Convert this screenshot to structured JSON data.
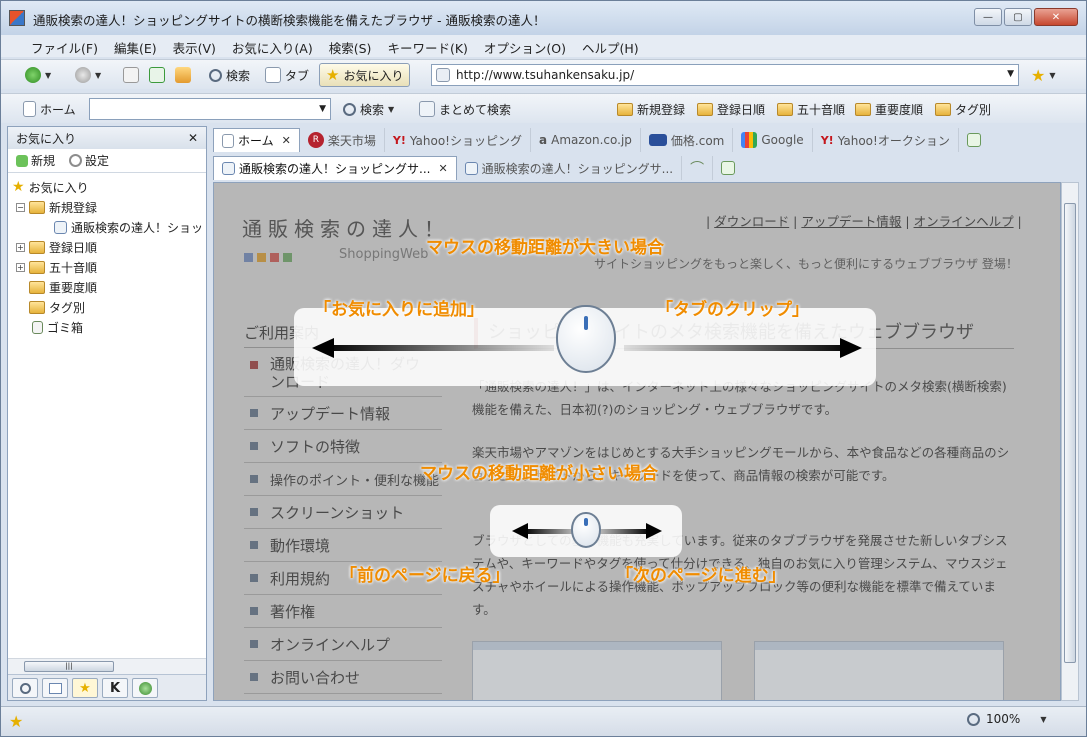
{
  "window": {
    "title": "通販検索の達人！ショッピングサイトの横断検索機能を備えたブラウザ - 通販検索の達人！",
    "controls": [
      "—",
      "▢",
      "✕"
    ]
  },
  "menu": [
    "ファイル(F)",
    "編集(E)",
    "表示(V)",
    "お気に入り(A)",
    "検索(S)",
    "キーワード(K)",
    "オプション(O)",
    "ヘルプ(H)"
  ],
  "toolbar": {
    "search_label": "検索",
    "tab_label": "タブ",
    "favorites_label": "お気に入り",
    "address": "http://www.tsuhankensaku.jp/"
  },
  "toolbar2": {
    "home_label": "ホーム",
    "search_label": "検索",
    "batch_search_label": "まとめて検索",
    "keywords": [
      "新規登録",
      "登録日順",
      "五十音順",
      "重要度順",
      "タグ別"
    ]
  },
  "sidebar": {
    "title": "お気に入り",
    "close": "✕",
    "new_label": "新規",
    "settings_label": "設定",
    "tree": [
      {
        "label": "お気に入り",
        "level": 0
      },
      {
        "label": "新規登録",
        "level": 1,
        "expander": "−"
      },
      {
        "label": "通販検索の達人！ショッ",
        "level": 2
      },
      {
        "label": "登録日順",
        "level": 1,
        "expander": "+"
      },
      {
        "label": "五十音順",
        "level": 1,
        "expander": "+"
      },
      {
        "label": "重要度順",
        "level": 1
      },
      {
        "label": "タグ別",
        "level": 1
      },
      {
        "label": "ゴミ箱",
        "level": 1
      }
    ],
    "bottom_k": "K"
  },
  "tabs_row1": [
    "ホーム",
    "楽天市場",
    "Yahoo!ショッピング",
    "Amazon.co.jp",
    "価格.com",
    "Google",
    "Yahoo!オークション"
  ],
  "tabs_row2": [
    "通販検索の達人！ショッピングサ...",
    "通販検索の達人！ショッピングサ..."
  ],
  "tab_close": "✕",
  "page": {
    "title": "通販検索の達人！",
    "subtitle": "ShoppingWeb",
    "links": [
      "ダウンロード",
      "アップデート情報",
      "オンラインヘルプ"
    ],
    "tagline": "サイトショッピングをもっと楽しく、もっと便利にするウェブブラウザ 登場！",
    "guide_title": "ご利用案内",
    "nav": [
      "通販検索の達人！ダウンロード",
      "アップデート情報",
      "ソフトの特徴",
      "操作のポイント・便利な機能",
      "スクリーンショット",
      "動作環境",
      "利用規約",
      "著作権",
      "オンラインヘルプ",
      "お問い合わせ"
    ],
    "section_head": "ショッピングサイトのメタ検索機能を備えたウェブブラウザ",
    "para1": "「通販検索の達人！」は、インターネット上の様々なショッピングサイトのメタ検索(横断検索)機能を備えた、日本初(?)のショッピング・ウェブブラウザです。",
    "para2": "楽天市場やアマゾンをはじめとする大手ショッピングモールから、本や食品などの各種商品のショッピングサイトから、キーワードを使って、商品情報の検索が可能です。",
    "para3": "ブラウザとしての基本機能も充実しています。従来のタブブラウザを発展させた新しいタブシステムや、キーワードやタグを使って仕分けできる、独自のお気に入り管理システム、マウスジェスチャやホイールによる操作機能、ポップアップブロック等の便利な機能を標準で備えています。"
  },
  "overlay": {
    "large_move": "マウスの移動距離が大きい場合",
    "add_favorite": "「お気に入りに追加」",
    "tab_clip": "「タブのクリップ」",
    "small_move": "マウスの移動距離が小さい場合",
    "back": "「前のページに戻る」",
    "forward": "「次のページに進む」"
  },
  "status": {
    "zoom": "100%"
  },
  "colors": {
    "accent": "#f08c00",
    "chrome": "#d9e2ee"
  }
}
